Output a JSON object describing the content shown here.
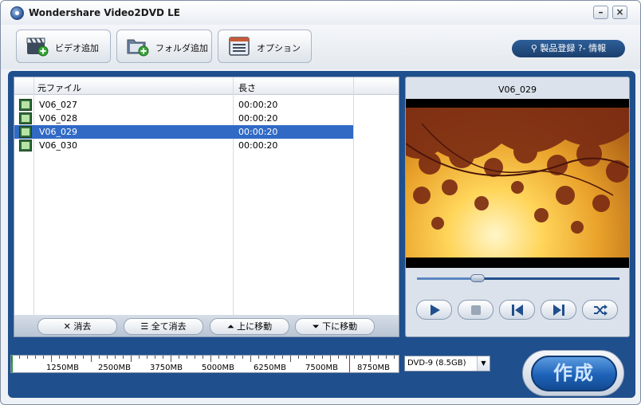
{
  "window": {
    "title": "Wondershare Video2DVD LE"
  },
  "toolbar": {
    "add_video": "ビデオ追加",
    "add_folder": "フォルダ追加",
    "options": "オプション",
    "register_info": "製品登録 ?- 情報"
  },
  "filelist": {
    "col_source": "元ファイル",
    "col_length": "長さ",
    "rows": [
      {
        "name": "V06_027",
        "length": "00:00:20"
      },
      {
        "name": "V06_028",
        "length": "00:00:20"
      },
      {
        "name": "V06_029",
        "length": "00:00:20"
      },
      {
        "name": "V06_030",
        "length": "00:00:20"
      }
    ],
    "selected_index": 2
  },
  "actions": {
    "delete": "消去",
    "delete_all": "全て消去",
    "move_up": "上に移動",
    "move_down": "下に移動"
  },
  "preview": {
    "title": "V06_029",
    "seek_fraction": 0.3
  },
  "capacity": {
    "labels": [
      "1250MB",
      "2500MB",
      "3750MB",
      "5000MB",
      "6250MB",
      "7500MB",
      "8750MB"
    ],
    "disc_type": "DVD-9 (8.5GB)"
  },
  "make_button": "作成",
  "colors": {
    "main_blue": "#1f4f8c",
    "selection": "#316ac5"
  }
}
